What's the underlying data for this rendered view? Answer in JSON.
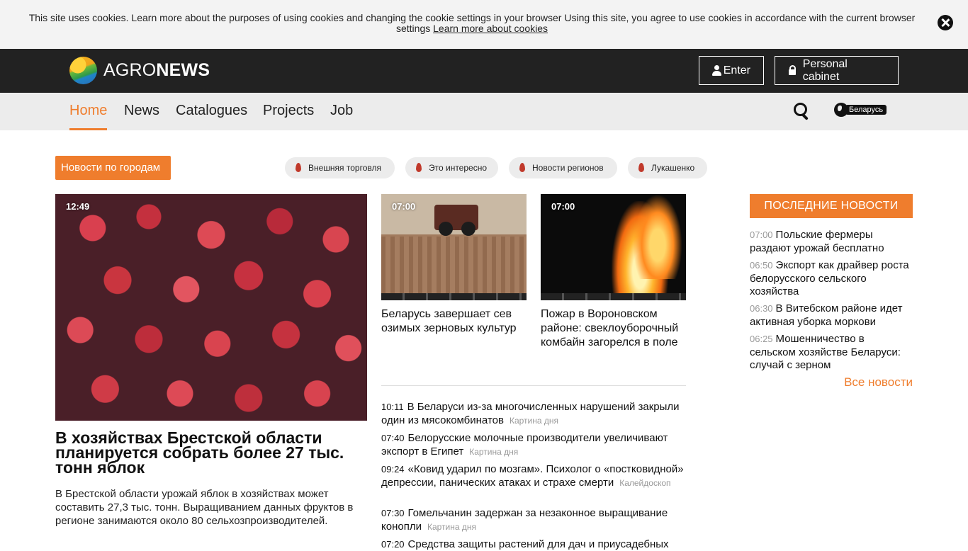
{
  "cookie": {
    "text": "This site uses cookies. Learn more about the purposes of using cookies and changing the cookie settings in your browser Using this site, you agree to use cookies in accordance with the current browser settings",
    "link": "Learn more about cookies"
  },
  "header": {
    "logo_light": "AGRO",
    "logo_bold": "NEWS",
    "enter_label": "Enter",
    "cabinet_label": "Personal cabinet"
  },
  "nav": {
    "items": [
      "Home",
      "News",
      "Catalogues",
      "Projects",
      "Job"
    ],
    "region": "Беларусь"
  },
  "tags": {
    "city_button": "Новости по городам",
    "items": [
      "Внешняя торговля",
      "Это интересно",
      "Новости регионов",
      "Лукашенко"
    ]
  },
  "lead": {
    "time": "12:49",
    "title": "В хозяйствах Брестской области планируется собрать более 27 тыс. тонн яблок",
    "desc": "В Брестской области урожай яблок в хозяйствах может составить 27,3 тыс. тонн. Выращиванием данных фруктов в регионе занимаются около 80 сельхозпроизводителей."
  },
  "cards": [
    {
      "time": "07:00",
      "title": "Беларусь завершает сев озимых зерновых культур"
    },
    {
      "time": "07:00",
      "title": "Пожар в Вороновском районе: свеклоуборочный комбайн загорелся в поле"
    }
  ],
  "news_list": [
    {
      "time": "10:11",
      "title": "В Беларуси из-за многочисленных нарушений закрыли один из мясокомбинатов",
      "category": "Картина дня"
    },
    {
      "time": "07:40",
      "title": "Белорусские молочные производители увеличивают экспорт в Египет",
      "category": "Картина дня"
    },
    {
      "time": "09:24",
      "title": "«Ковид ударил по мозгам». Психолог о «постковидной» депрессии, панических атаках и страхе смерти",
      "category": "Калейдоскоп"
    },
    {
      "time": "07:30",
      "title": "Гомельчанин задержан за незаконное выращивание конопли",
      "category": "Картина дня"
    },
    {
      "time": "07:20",
      "title": "Средства защиты растений для дач и приусадебных",
      "category": ""
    }
  ],
  "sidebar": {
    "title": "ПОСЛЕДНИЕ НОВОСТИ",
    "items": [
      {
        "time": "07:00",
        "title": "Польские фермеры раздают урожай бесплатно"
      },
      {
        "time": "06:50",
        "title": "Экспорт как драйвер роста белорусского сельского хозяйства"
      },
      {
        "time": "06:30",
        "title": "В Витебском районе идет активная уборка моркови"
      },
      {
        "time": "06:25",
        "title": "Мошенничество в сельском хозяйстве Беларуси: случай с зерном"
      }
    ],
    "all_news": "Все новости"
  },
  "colors": {
    "accent": "#ef7d2d",
    "header_bg": "#222222",
    "nav_bg": "#ececec"
  }
}
